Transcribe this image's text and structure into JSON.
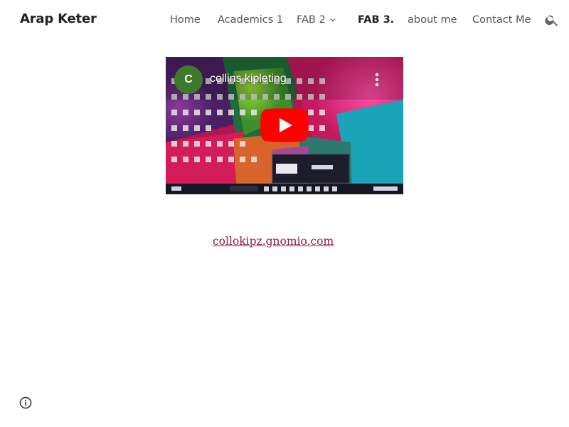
{
  "site": {
    "title": "Arap Keter"
  },
  "nav": {
    "items": [
      {
        "label": "Home"
      },
      {
        "label": "Academics 1"
      },
      {
        "label": "FAB 2"
      },
      {
        "label": "FAB 3."
      },
      {
        "label": "about me"
      },
      {
        "label": "Contact Me"
      }
    ],
    "active_index": 3,
    "search_icon": "search-icon",
    "dropdown_icon": "chevron-down-icon"
  },
  "video": {
    "channel_initial": "C",
    "channel_name": "collins kipleting",
    "play_icon": "youtube-play-icon",
    "menu_icon": "more-vert-icon",
    "colors": {
      "avatar": "#3d7a2b",
      "play": "#ff0000"
    }
  },
  "content": {
    "link_text": "collokipz.gnomio.com"
  },
  "footer": {
    "info_icon": "info-icon"
  },
  "colors": {
    "link": "#8c1d40",
    "nav_text": "#545454",
    "title": "#212121"
  }
}
